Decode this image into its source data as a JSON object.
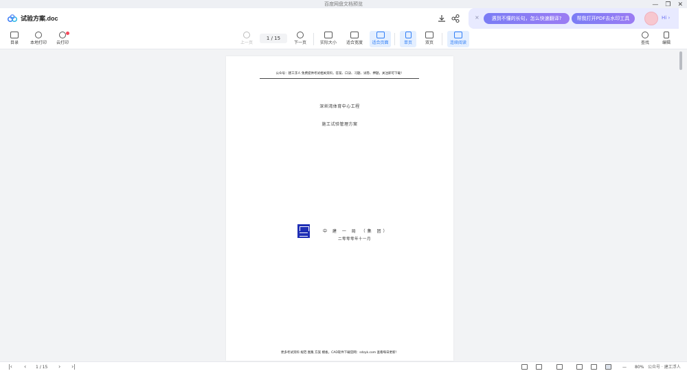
{
  "window": {
    "title": "百度网盘文档预览",
    "minimize": "—",
    "restore": "❐",
    "close": "✕"
  },
  "header": {
    "doc_title": "试验方案.doc",
    "download_icon": "download-icon",
    "share_icon": "share-icon"
  },
  "promo": {
    "close": "×",
    "pill1": "遇到不懂的长句，怎么快速翻译?",
    "pill2": "帮我打开PDF去水印工具",
    "greeting": "Hi",
    "chevron": "›"
  },
  "toolbar": {
    "toc": "目录",
    "local_print": "本地打印",
    "cloud_print": "云打印",
    "prev_page": "上一页",
    "page_indicator": "1 / 15",
    "next_page": "下一页",
    "actual_size": "实际大小",
    "fit_width": "适合宽度",
    "fit_page": "适合页面",
    "single_page": "单页",
    "double_page": "双页",
    "continuous": "连续阅读",
    "search": "查找",
    "edit": "编辑"
  },
  "document": {
    "header_text": "公众号：建工浮人 免费提供考试相关资料，答案、口诀、习题、试卷、押题，关注即可下载！",
    "line1": "深圳湾体育中心工程",
    "line2": "施工试验管理方案",
    "company": "中 建 一 局 （集 团）",
    "date": "二零零零年十一月",
    "footer_text": "更多考试资料 规范 图集 方案 模板，CAD软件下载官网：sdzyk.com 查看每日更新！"
  },
  "statusbar": {
    "first": "|‹",
    "prev": "‹",
    "page": "1 / 15",
    "next": "›",
    "last": "›|",
    "zoom_out": "—",
    "zoom": "80%",
    "watermark": "公众号 · 建工浮人"
  }
}
